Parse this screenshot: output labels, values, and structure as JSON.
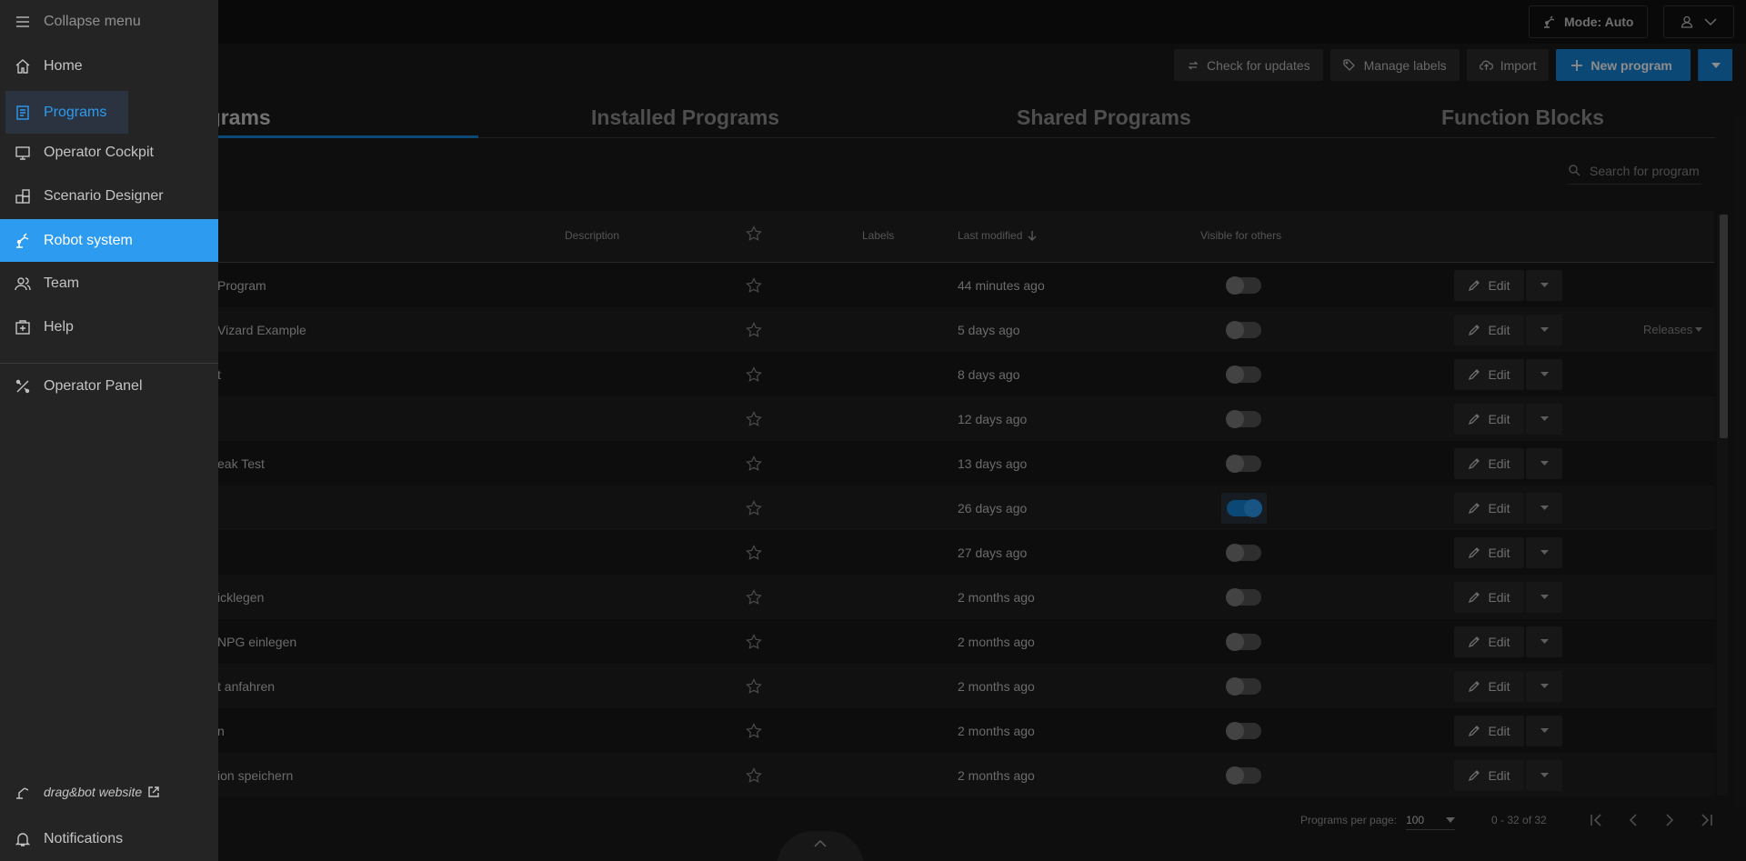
{
  "topbar": {
    "mode_label": "Mode: Auto"
  },
  "actions": {
    "check_updates": "Check for updates",
    "manage_labels": "Manage labels",
    "import": "Import",
    "new_program": "New program"
  },
  "tabs": [
    "My Programs",
    "Installed Programs",
    "Shared Programs",
    "Function Blocks"
  ],
  "search": {
    "placeholder": "Search for program"
  },
  "table": {
    "headers": {
      "description": "Description",
      "labels": "Labels",
      "last_modified": "Last modified",
      "visible": "Visible for others"
    },
    "edit_label": "Edit",
    "releases_label": "Releases",
    "rows": [
      {
        "name": "Program",
        "modified": "44 minutes ago",
        "visible": false
      },
      {
        "name": "Vizard Example",
        "modified": "5 days ago",
        "visible": false
      },
      {
        "name": "t",
        "modified": "8 days ago",
        "visible": false
      },
      {
        "name": "",
        "modified": "12 days ago",
        "visible": false
      },
      {
        "name": "eak Test",
        "modified": "13 days ago",
        "visible": false
      },
      {
        "name": "",
        "modified": "26 days ago",
        "visible": true
      },
      {
        "name": "",
        "modified": "27 days ago",
        "visible": false
      },
      {
        "name": "icklegen",
        "modified": "2 months ago",
        "visible": false
      },
      {
        "name": "NPG einlegen",
        "modified": "2 months ago",
        "visible": false
      },
      {
        "name": "t anfahren",
        "modified": "2 months ago",
        "visible": false
      },
      {
        "name": "n",
        "modified": "2 months ago",
        "visible": false
      },
      {
        "name": "ion speichern",
        "modified": "2 months ago",
        "visible": false
      }
    ]
  },
  "pager": {
    "per_page_label": "Programs per page:",
    "per_page_value": "100",
    "count": "0 - 32 of 32"
  },
  "menu": {
    "collapse": "Collapse menu",
    "items": [
      {
        "label": "Home",
        "icon": "home-icon"
      },
      {
        "label": "Programs",
        "icon": "programs-icon"
      },
      {
        "label": "Operator Cockpit",
        "icon": "monitor-icon"
      },
      {
        "label": "Scenario Designer",
        "icon": "blocks-icon"
      },
      {
        "label": "Robot system",
        "icon": "robot-arm-icon"
      },
      {
        "label": "Team",
        "icon": "team-icon"
      },
      {
        "label": "Help",
        "icon": "help-icon"
      },
      {
        "label": "Operator Panel",
        "icon": "operator-panel-icon"
      }
    ],
    "website": "drag&bot website",
    "notifications": "Notifications"
  },
  "colors": {
    "accent": "#1684d7",
    "active_menu": "#2d9cf0"
  }
}
